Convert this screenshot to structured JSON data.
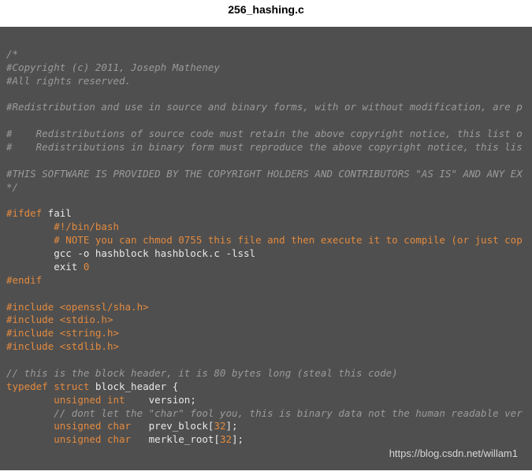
{
  "title": "256_hashing.c",
  "watermark": "https://blog.csdn.net/willam1",
  "code": {
    "c1": "/*",
    "c2": "#Copyright (c) 2011, Joseph Matheney",
    "c3": "#All rights reserved.",
    "c4": "#Redistribution and use in source and binary forms, with or without modification, are p",
    "c5": "#    Redistributions of source code must retain the above copyright notice, this list o",
    "c6": "#    Redistributions in binary form must reproduce the above copyright notice, this lis",
    "c7": "#THIS SOFTWARE IS PROVIDED BY THE COPYRIGHT HOLDERS AND CONTRIBUTORS \"AS IS\" AND ANY EX",
    "c8": "*/",
    "ifdef": "#ifdef",
    "ifdef_arg": " fail",
    "shebang": "        #!/bin/bash",
    "note": "        # NOTE you can chmod 0755 this file and then execute it to compile (or just cop",
    "gcc": "        gcc -o hashblock hashblock.c -lssl",
    "exit_kw": "        exit ",
    "exit_code": "0",
    "endif": "#endif",
    "inc1_a": "#include",
    "inc1_b": " <openssl/sha.h>",
    "inc2_a": "#include",
    "inc2_b": " <stdio.h>",
    "inc3_a": "#include",
    "inc3_b": " <string.h>",
    "inc4_a": "#include",
    "inc4_b": " <stdlib.h>",
    "hc1": "// this is the block header, it is 80 bytes long (steal this code)",
    "td": "typedef",
    "st": " struct",
    "bh": " block_header {",
    "f1_pad": "        ",
    "f1_type": "unsigned int",
    "f1_name": "    version;",
    "hc2": "        // dont let the \"char\" fool you, this is binary data not the human readable ver",
    "f2_pad": "        ",
    "f2_type": "unsigned char",
    "f2_name": "   prev_block[",
    "f2_num": "32",
    "f2_end": "];",
    "f3_pad": "        ",
    "f3_type": "unsigned char",
    "f3_name": "   merkle_root[",
    "f3_num": "32",
    "f3_end": "];"
  }
}
